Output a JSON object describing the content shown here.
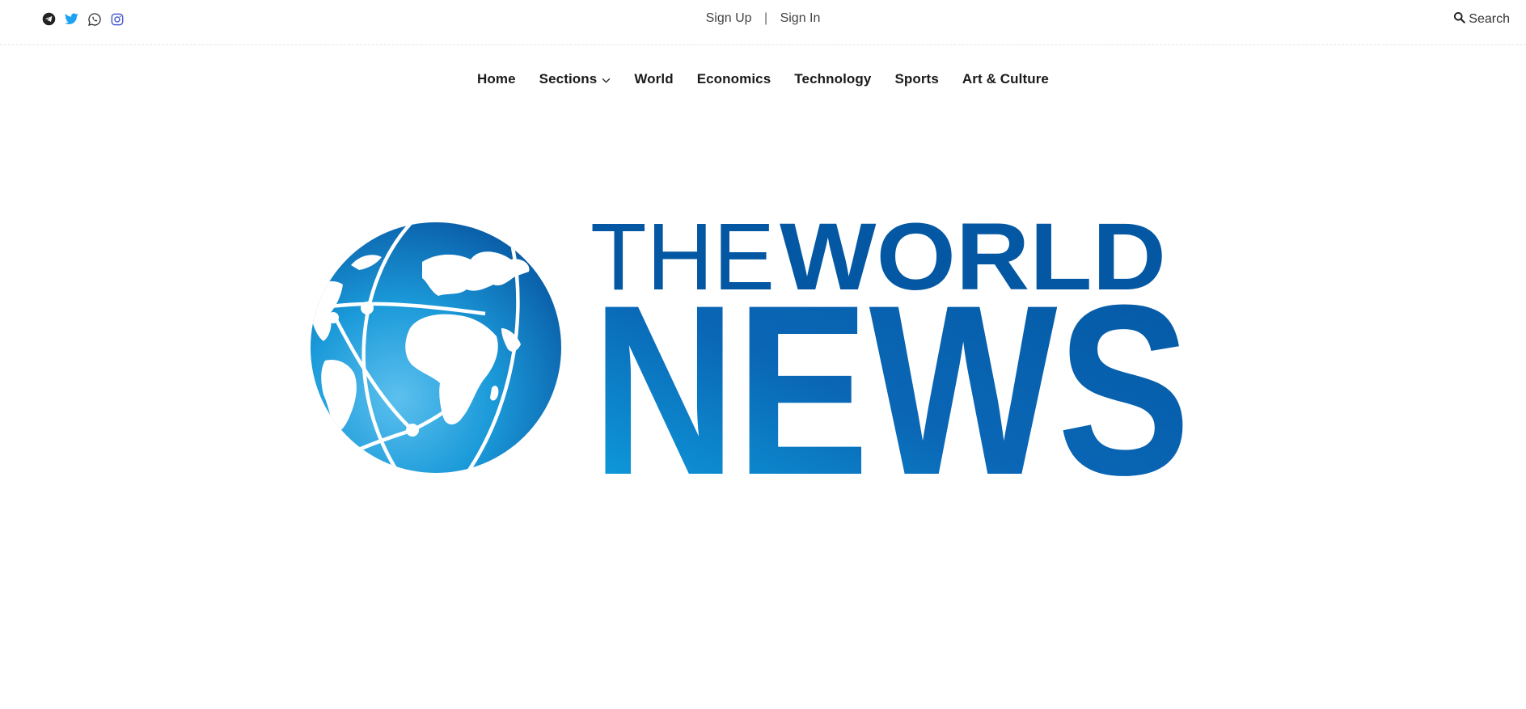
{
  "topbar": {
    "social": [
      {
        "icon": "telegram-icon",
        "color": "#222222"
      },
      {
        "icon": "twitter-icon",
        "color": "#1da1f2"
      },
      {
        "icon": "whatsapp-icon",
        "color": "#333333"
      },
      {
        "icon": "instagram-icon",
        "color": "#4a5fd1"
      }
    ],
    "signup_label": "Sign Up",
    "separator": "|",
    "signin_label": "Sign In",
    "search_label": "Search",
    "search_icon": "search-icon"
  },
  "nav": {
    "items": [
      {
        "label": "Home"
      },
      {
        "label": "Sections",
        "icon": "chevron-down-icon"
      },
      {
        "label": "World"
      },
      {
        "label": "Economics"
      },
      {
        "label": "Technology"
      },
      {
        "label": "Sports"
      },
      {
        "label": "Art & Culture"
      }
    ]
  },
  "logo": {
    "word_the": "THE",
    "word_world": "WORLD",
    "word_news": "NEWS",
    "colors": {
      "dark_blue": "#0458a3",
      "mid_blue": "#0a72c0",
      "light_blue": "#1fa3e0"
    }
  }
}
